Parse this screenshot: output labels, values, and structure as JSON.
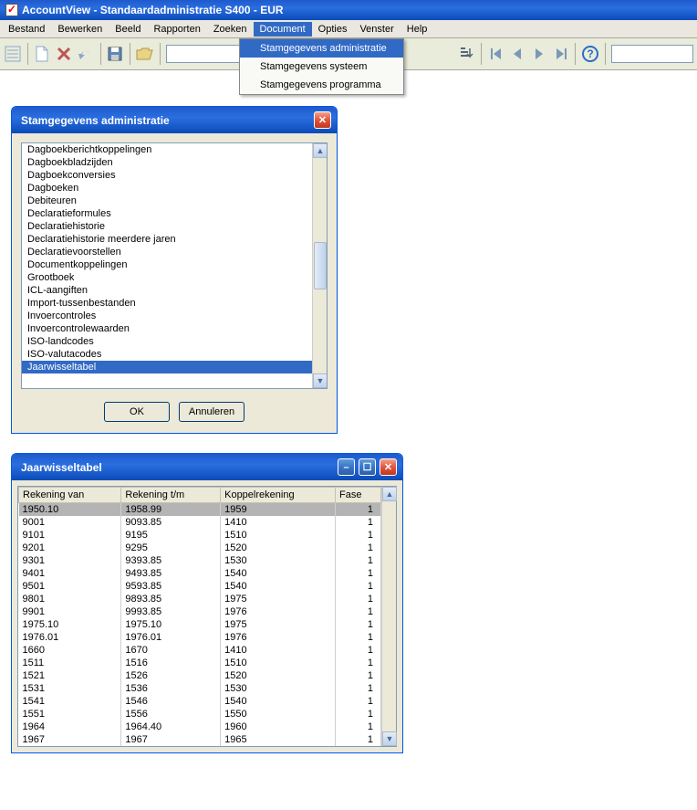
{
  "app": {
    "title": "AccountView - Standaardadministratie S400 - EUR"
  },
  "menubar": {
    "items": [
      "Bestand",
      "Bewerken",
      "Beeld",
      "Rapporten",
      "Zoeken",
      "Document",
      "Opties",
      "Venster",
      "Help"
    ],
    "active_index": 5
  },
  "dropdown": {
    "items": [
      "Stamgegevens administratie",
      "Stamgegevens systeem",
      "Stamgegevens programma"
    ],
    "highlighted_index": 0
  },
  "dialog1": {
    "title": "Stamgegevens administratie",
    "items": [
      "Dagboekberichtkoppelingen",
      "Dagboekbladzijden",
      "Dagboekconversies",
      "Dagboeken",
      "Debiteuren",
      "Declaratieformules",
      "Declaratiehistorie",
      "Declaratiehistorie meerdere jaren",
      "Declaratievoorstellen",
      "Documentkoppelingen",
      "Grootboek",
      "ICL-aangiften",
      "Import-tussenbestanden",
      "Invoercontroles",
      "Invoercontrolewaarden",
      "ISO-landcodes",
      "ISO-valutacodes",
      "Jaarwisseltabel"
    ],
    "selected_index": 17,
    "ok_label": "OK",
    "cancel_label": "Annuleren"
  },
  "dialog2": {
    "title": "Jaarwisseltabel",
    "columns": [
      "Rekening van",
      "Rekening t/m",
      "Koppelrekening",
      "Fase"
    ],
    "rows": [
      [
        "1950.10",
        "1958.99",
        "1959",
        "1"
      ],
      [
        "9001",
        "9093.85",
        "1410",
        "1"
      ],
      [
        "9101",
        "9195",
        "1510",
        "1"
      ],
      [
        "9201",
        "9295",
        "1520",
        "1"
      ],
      [
        "9301",
        "9393.85",
        "1530",
        "1"
      ],
      [
        "9401",
        "9493.85",
        "1540",
        "1"
      ],
      [
        "9501",
        "9593.85",
        "1540",
        "1"
      ],
      [
        "9801",
        "9893.85",
        "1975",
        "1"
      ],
      [
        "9901",
        "9993.85",
        "1976",
        "1"
      ],
      [
        "1975.10",
        "1975.10",
        "1975",
        "1"
      ],
      [
        "1976.01",
        "1976.01",
        "1976",
        "1"
      ],
      [
        "1660",
        "1670",
        "1410",
        "1"
      ],
      [
        "1511",
        "1516",
        "1510",
        "1"
      ],
      [
        "1521",
        "1526",
        "1520",
        "1"
      ],
      [
        "1531",
        "1536",
        "1530",
        "1"
      ],
      [
        "1541",
        "1546",
        "1540",
        "1"
      ],
      [
        "1551",
        "1556",
        "1550",
        "1"
      ],
      [
        "1964",
        "1964.40",
        "1960",
        "1"
      ],
      [
        "1967",
        "1967",
        "1965",
        "1"
      ]
    ],
    "selected_row": 0
  }
}
